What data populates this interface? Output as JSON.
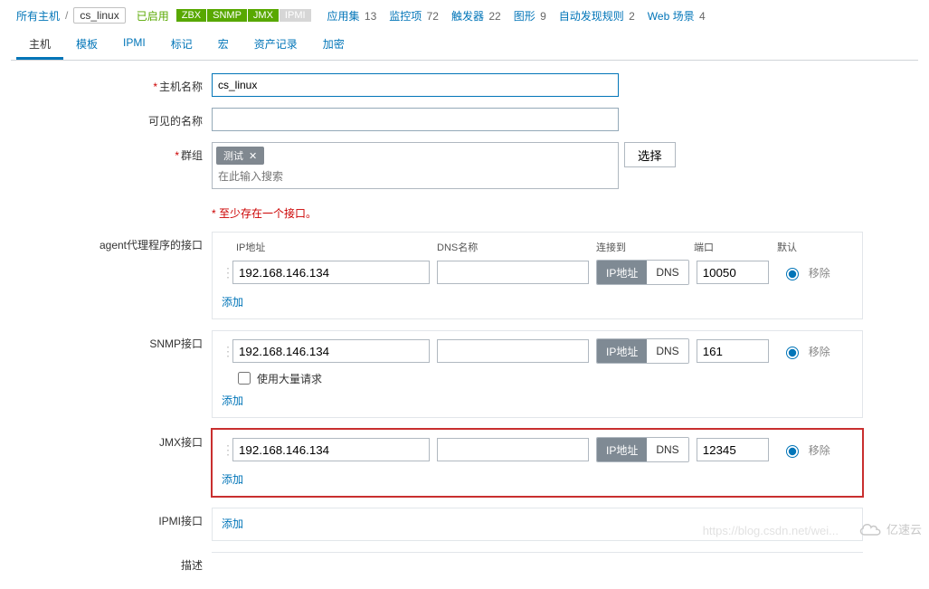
{
  "breadcrumb": {
    "all_hosts": "所有主机",
    "current": "cs_linux"
  },
  "status_enabled": "已启用",
  "avail_tags": {
    "zbx": "ZBX",
    "snmp": "SNMP",
    "jmx": "JMX",
    "ipmi": "IPMI"
  },
  "counts": {
    "apps_l": "应用集",
    "apps_n": "13",
    "items_l": "监控项",
    "items_n": "72",
    "trig_l": "触发器",
    "trig_n": "22",
    "graphs_l": "图形",
    "graphs_n": "9",
    "lld_l": "自动发现规则",
    "lld_n": "2",
    "web_l": "Web 场景",
    "web_n": "4"
  },
  "tabs": {
    "host": "主机",
    "templates": "模板",
    "ipmi": "IPMI",
    "tags": "标记",
    "macros": "宏",
    "inventory": "资产记录",
    "encryption": "加密"
  },
  "labels": {
    "hostname": "主机名称",
    "visible": "可见的名称",
    "groups": "群组",
    "groups_select": "选择",
    "groups_search_ph": "在此输入搜索",
    "at_least_one": "至少存在一个接口。",
    "agent": "agent代理程序的接口",
    "snmp": "SNMP接口",
    "jmx": "JMX接口",
    "ipmi_iface": "IPMI接口",
    "desc": "描述",
    "col_ip": "IP地址",
    "col_dns": "DNS名称",
    "col_conn": "连接到",
    "col_port": "端口",
    "col_default": "默认",
    "ip_btn": "IP地址",
    "dns_btn": "DNS",
    "add": "添加",
    "remove": "移除",
    "bulk": "使用大量请求"
  },
  "values": {
    "hostname": "cs_linux",
    "visible": "",
    "group_tag": "测试"
  },
  "interfaces": {
    "agent": {
      "ip": "192.168.146.134",
      "dns": "",
      "port": "10050"
    },
    "snmp": {
      "ip": "192.168.146.134",
      "dns": "",
      "port": "161"
    },
    "jmx": {
      "ip": "192.168.146.134",
      "dns": "",
      "port": "12345"
    }
  },
  "watermark": {
    "url": "https://blog.csdn.net/wei...",
    "brand": "亿速云"
  }
}
